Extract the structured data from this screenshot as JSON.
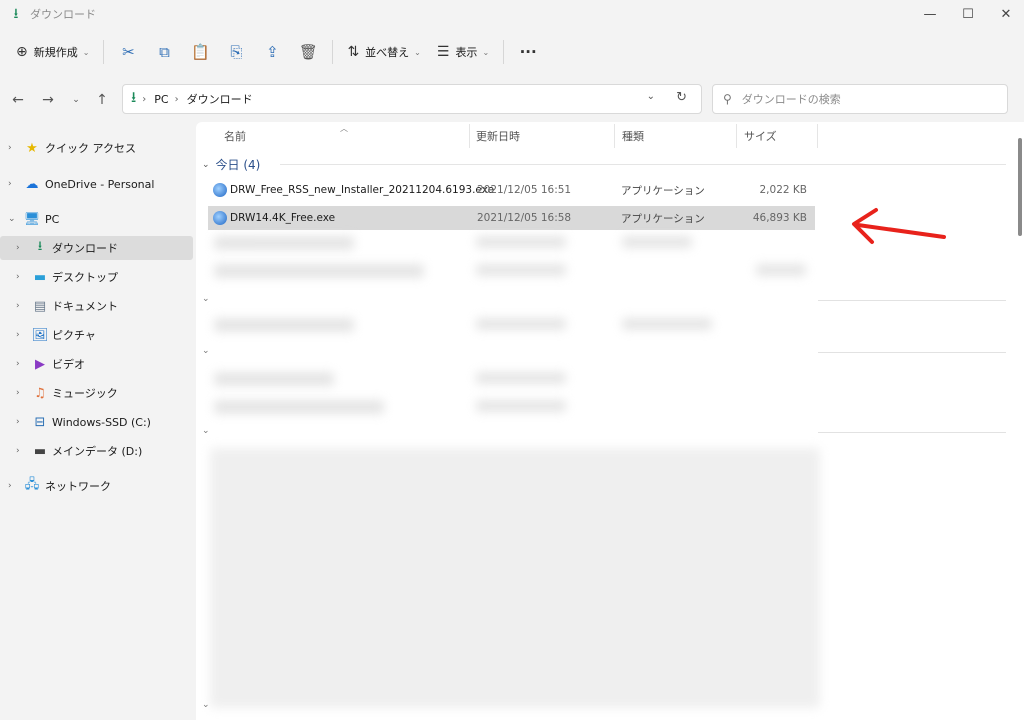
{
  "window": {
    "title": "ダウンロード"
  },
  "toolbar": {
    "new_label": "新規作成",
    "sort_label": "並べ替え",
    "view_label": "表示"
  },
  "address": {
    "crumbs": [
      "PC",
      "ダウンロード"
    ]
  },
  "search": {
    "placeholder": "ダウンロードの検索"
  },
  "sidebar": {
    "items": [
      {
        "label": "クイック アクセス"
      },
      {
        "label": "OneDrive - Personal"
      },
      {
        "label": "PC"
      },
      {
        "label": "ダウンロード"
      },
      {
        "label": "デスクトップ"
      },
      {
        "label": "ドキュメント"
      },
      {
        "label": "ピクチャ"
      },
      {
        "label": "ビデオ"
      },
      {
        "label": "ミュージック"
      },
      {
        "label": "Windows-SSD (C:)"
      },
      {
        "label": "メインデータ (D:)"
      },
      {
        "label": "ネットワーク"
      }
    ]
  },
  "columns": {
    "name": "名前",
    "date": "更新日時",
    "type": "種類",
    "size": "サイズ"
  },
  "group": {
    "label": "今日 (4)"
  },
  "files": [
    {
      "name": "DRW_Free_RSS_new_Installer_20211204.6193.exe",
      "date": "2021/12/05 16:51",
      "type": "アプリケーション",
      "size": "2,022 KB"
    },
    {
      "name": "DRW14.4K_Free.exe",
      "date": "2021/12/05 16:58",
      "type": "アプリケーション",
      "size": "46,893 KB"
    }
  ],
  "colors": {
    "accent": "#1b8a5a",
    "annotation_arrow": "#e8221b",
    "group_text": "#2b4f8a"
  },
  "icons": {
    "app": "download-arrow-icon",
    "nav_back": "arrow-left-icon",
    "nav_forward": "arrow-right-icon",
    "nav_up": "arrow-up-icon",
    "refresh": "refresh-icon",
    "search": "search-icon"
  }
}
